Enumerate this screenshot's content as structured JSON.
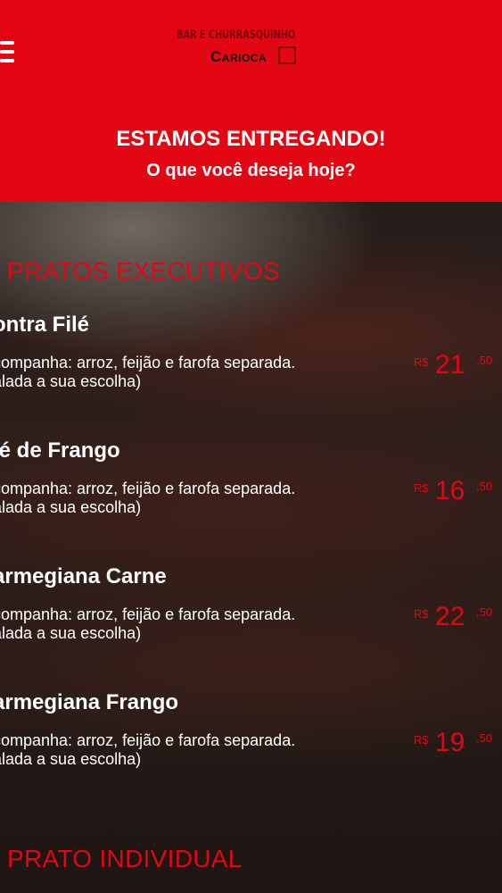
{
  "header": {
    "logo_top": "BAR E CHURRASQUINHO",
    "logo_bottom": "Carioca",
    "headline": "ESTAMOS ENTREGANDO!",
    "subhead": "O que você deseja hoje?"
  },
  "sections": [
    {
      "title": "PRATOS EXECUTIVOS"
    },
    {
      "title": "PRATO INDIVIDUAL"
    }
  ],
  "items": [
    {
      "name": "ontra Filé",
      "desc1": "companha: arroz, feijão e farofa separada.",
      "desc2": "alada a sua escolha)",
      "currency": "R$",
      "price_int": "21",
      "price_dec": ",50"
    },
    {
      "name": "lé de Frango",
      "desc1": "companha: arroz, feijão e farofa separada.",
      "desc2": "alada a sua escolha)",
      "currency": "R$",
      "price_int": "16",
      "price_dec": ",50"
    },
    {
      "name": "armegiana Carne",
      "desc1": "companha: arroz, feijão e farofa separada.",
      "desc2": "alada a sua escolha)",
      "currency": "R$",
      "price_int": "22",
      "price_dec": ",50"
    },
    {
      "name": "armegiana Frango",
      "desc1": "companha: arroz, feijão e farofa separada.",
      "desc2": "alada a sua escolha)",
      "currency": "R$",
      "price_int": "19",
      "price_dec": ",50"
    }
  ],
  "colors": {
    "brand_red": "#e30613",
    "text": "#ffffff"
  },
  "icons": {
    "menu": "hamburger-menu-icon"
  }
}
